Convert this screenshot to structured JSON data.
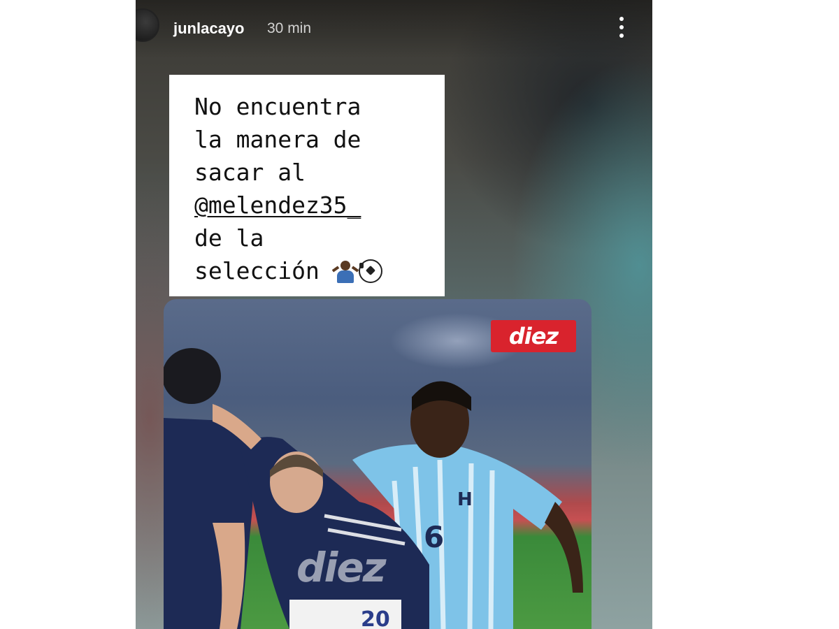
{
  "header": {
    "username": "junlacayo",
    "time": "30 min",
    "menu_icon": "more-vertical-icon"
  },
  "sticker": {
    "lines": [
      "No encuentra",
      "la manera de",
      "sacar al"
    ],
    "mention": "@melendez35_",
    "lines_after": [
      "de la"
    ],
    "last_line": "selección",
    "emojis": [
      "person-shrugging-icon",
      "soccer-ball-icon"
    ]
  },
  "photo": {
    "logo": "diez",
    "watermark": "diez",
    "jersey_numbers": [
      "6",
      "20"
    ]
  },
  "colors": {
    "logo_red": "#d9232d",
    "honduras_blue": "#7ec3e8",
    "argentina_navy": "#1d2a55"
  }
}
